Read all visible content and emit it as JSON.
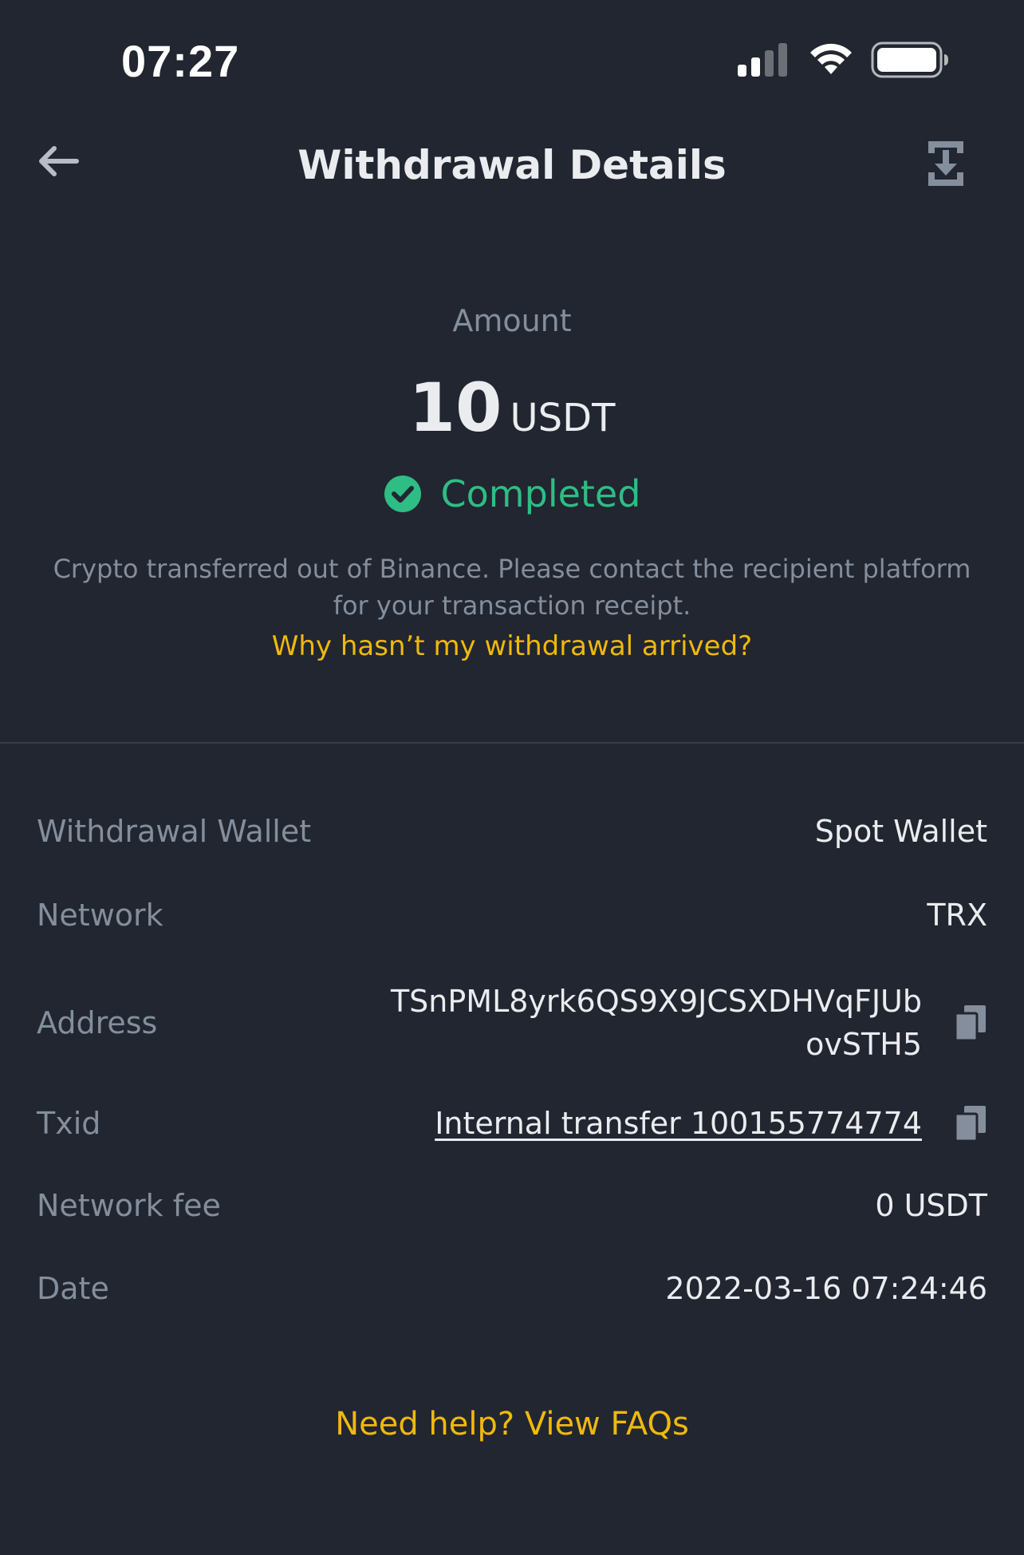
{
  "status_bar": {
    "time": "07:27",
    "icons": [
      "signal-icon",
      "wifi-icon",
      "battery-icon"
    ]
  },
  "header": {
    "title": "Withdrawal Details",
    "back_icon": "back-arrow-icon",
    "action_icon": "download-icon"
  },
  "summary": {
    "amount_label": "Amount",
    "amount_value": "10",
    "amount_unit": "USDT",
    "status_icon": "check-circle-icon",
    "status": "Completed",
    "description": "Crypto transferred out of Binance. Please contact the recipient platform for your transaction receipt.",
    "help_link": "Why hasn’t my withdrawal arrived?"
  },
  "details": {
    "wallet_label": "Withdrawal Wallet",
    "wallet_value": "Spot Wallet",
    "network_label": "Network",
    "network_value": "TRX",
    "address_label": "Address",
    "address_value": "TSnPML8yrk6QS9X9JCSXDHVqFJUbovSTH5",
    "txid_label": "Txid",
    "txid_value": "Internal transfer 100155774774",
    "fee_label": "Network fee",
    "fee_value": "0 USDT",
    "date_label": "Date",
    "date_value": "2022-03-16 07:24:46"
  },
  "footer": {
    "faq_link": "Need help? View FAQs"
  },
  "colors": {
    "background": "#212630",
    "primary_text": "#eaecef",
    "secondary_text": "#848e9c",
    "success": "#2ebd85",
    "accent": "#f0b90b",
    "divider": "#373d47"
  }
}
